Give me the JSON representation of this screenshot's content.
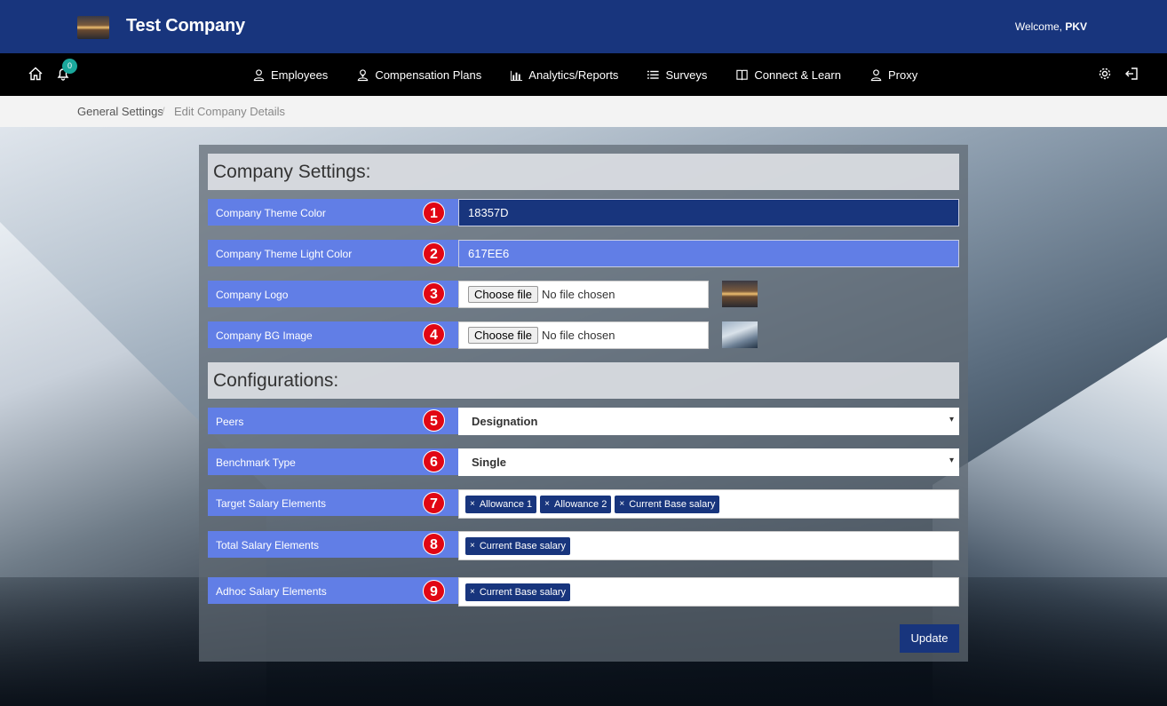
{
  "header": {
    "company_name": "Test Company",
    "welcome_prefix": "Welcome, ",
    "user": "PKV",
    "theme_color": "#18357D"
  },
  "nav": {
    "notification_count": "0",
    "items": [
      {
        "label": "Employees",
        "icon": "user-icon"
      },
      {
        "label": "Compensation Plans",
        "icon": "user-plan-icon"
      },
      {
        "label": "Analytics/Reports",
        "icon": "bar-chart-icon"
      },
      {
        "label": "Surveys",
        "icon": "list-icon"
      },
      {
        "label": "Connect & Learn",
        "icon": "book-icon"
      },
      {
        "label": "Proxy",
        "icon": "user-icon"
      }
    ]
  },
  "breadcrumb": {
    "parent": "General Settings",
    "separator": "/",
    "current": "Edit Company Details"
  },
  "company_settings": {
    "title": "Company Settings:",
    "theme_color_label": "Company Theme Color",
    "theme_color_value": "18357D",
    "theme_light_label": "Company Theme Light Color",
    "theme_light_value": "617EE6",
    "logo_label": "Company Logo",
    "bg_label": "Company BG Image",
    "choose_file": "Choose file",
    "no_file": "No file chosen"
  },
  "configurations": {
    "title": "Configurations:",
    "peers_label": "Peers",
    "peers_value": "Designation",
    "benchmark_label": "Benchmark Type",
    "benchmark_value": "Single",
    "target_label": "Target Salary Elements",
    "target_tags": [
      "Allowance 1",
      "Allowance 2",
      "Current Base salary"
    ],
    "total_label": "Total Salary Elements",
    "total_tags": [
      "Current Base salary"
    ],
    "adhoc_label": "Adhoc Salary Elements",
    "adhoc_tags": [
      "Current Base salary"
    ]
  },
  "markers": [
    "1",
    "2",
    "3",
    "4",
    "5",
    "6",
    "7",
    "8",
    "9"
  ],
  "tag_remove": "×",
  "select_caret": "▾",
  "update_label": "Update"
}
